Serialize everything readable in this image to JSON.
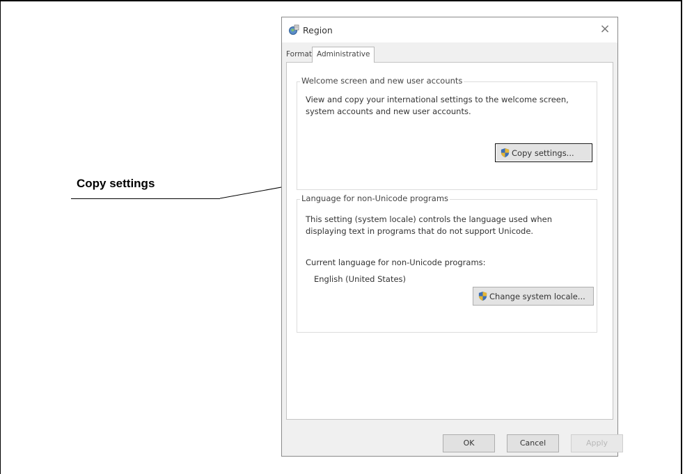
{
  "callout": {
    "label": "Copy settings"
  },
  "dialog": {
    "title": "Region",
    "close_glyph": "×",
    "tabs": [
      {
        "label": "Formats",
        "selected": false
      },
      {
        "label": "Administrative",
        "selected": true
      }
    ],
    "welcome_group": {
      "legend": "Welcome screen and new user accounts",
      "description": "View and copy your international settings to the welcome screen, system accounts and new user accounts.",
      "button_label": "Copy settings..."
    },
    "language_group": {
      "legend": "Language for non-Unicode programs",
      "description": "This setting (system locale) controls the language used when displaying text in programs that do not support Unicode.",
      "current_label": "Current language for non-Unicode programs:",
      "current_value": "English (United States)",
      "button_label": "Change system locale..."
    },
    "footer": {
      "ok_label": "OK",
      "cancel_label": "Cancel",
      "apply_label": "Apply"
    }
  },
  "icons": [
    "region-app-icon",
    "close-icon",
    "uac-shield-icon"
  ],
  "colors": {
    "dialog_bg": "#f0f0f0",
    "panel_bg": "#ffffff",
    "button_bg": "#e3e3e3",
    "focus_border": "#0b0b0b"
  }
}
